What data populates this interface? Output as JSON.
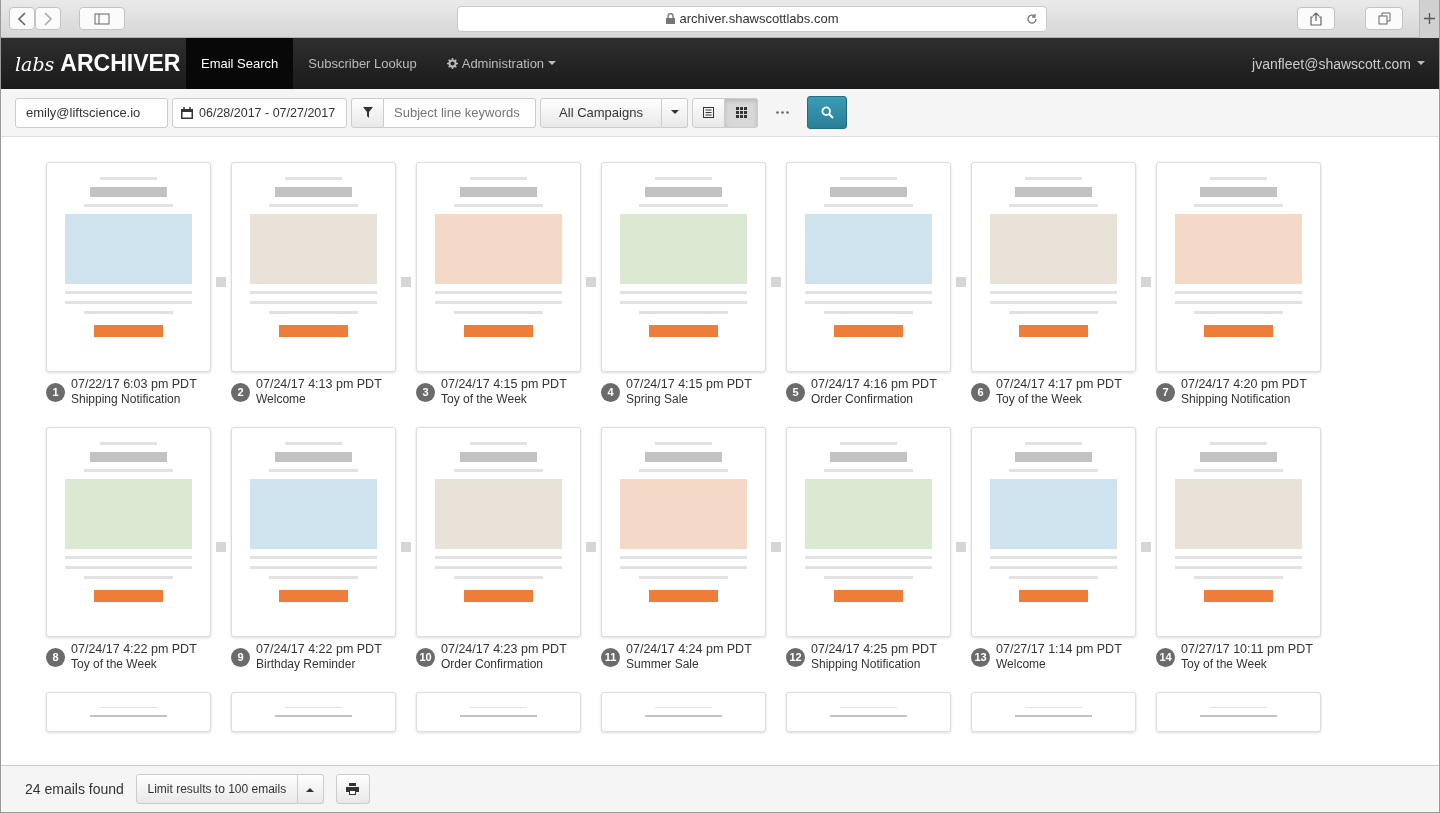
{
  "browser": {
    "url": "archiver.shawscottlabs.com"
  },
  "app": {
    "logo_prefix": "labs",
    "logo": "ARCHIVER",
    "nav": [
      {
        "label": "Email Search",
        "selected": true
      },
      {
        "label": "Subscriber Lookup",
        "selected": false
      },
      {
        "label": "Administration",
        "selected": false
      }
    ],
    "user": "jvanfleet@shawscott.com"
  },
  "toolbar": {
    "email": "emily@liftscience.io",
    "date_range": "06/28/2017 - 07/27/2017",
    "subject_placeholder": "Subject line keywords",
    "campaign": "All Campaigns",
    "view_modes": [
      {
        "kind": "list",
        "selected": false
      },
      {
        "kind": "grid",
        "selected": true
      }
    ]
  },
  "results": [
    {
      "number": "1",
      "datetime": "07/22/17 6:03 pm PDT",
      "campaign": "Shipping Notification"
    },
    {
      "number": "2",
      "datetime": "07/24/17 4:13 pm PDT",
      "campaign": "Welcome"
    },
    {
      "number": "3",
      "datetime": "07/24/17 4:15 pm PDT",
      "campaign": "Toy of the Week"
    },
    {
      "number": "4",
      "datetime": "07/24/17 4:15 pm PDT",
      "campaign": "Spring Sale"
    },
    {
      "number": "5",
      "datetime": "07/24/17 4:16 pm PDT",
      "campaign": "Order Confirmation"
    },
    {
      "number": "6",
      "datetime": "07/24/17 4:17 pm PDT",
      "campaign": "Toy of the Week"
    },
    {
      "number": "7",
      "datetime": "07/24/17 4:20 pm PDT",
      "campaign": "Shipping Notification"
    },
    {
      "number": "8",
      "datetime": "07/24/17 4:22 pm PDT",
      "campaign": "Toy of the Week"
    },
    {
      "number": "9",
      "datetime": "07/24/17 4:22 pm PDT",
      "campaign": "Birthday Reminder"
    },
    {
      "number": "10",
      "datetime": "07/24/17 4:23 pm PDT",
      "campaign": "Order Confirmation"
    },
    {
      "number": "11",
      "datetime": "07/24/17 4:24 pm PDT",
      "campaign": "Summer Sale"
    },
    {
      "number": "12",
      "datetime": "07/24/17 4:25 pm PDT",
      "campaign": "Shipping Notification"
    },
    {
      "number": "13",
      "datetime": "07/27/17 1:14 pm PDT",
      "campaign": "Welcome"
    },
    {
      "number": "14",
      "datetime": "07/27/17 10:11 pm PDT",
      "campaign": "Toy of the Week"
    }
  ],
  "footer": {
    "count": "24 emails found",
    "limit": "Limit results to 100 emails"
  }
}
